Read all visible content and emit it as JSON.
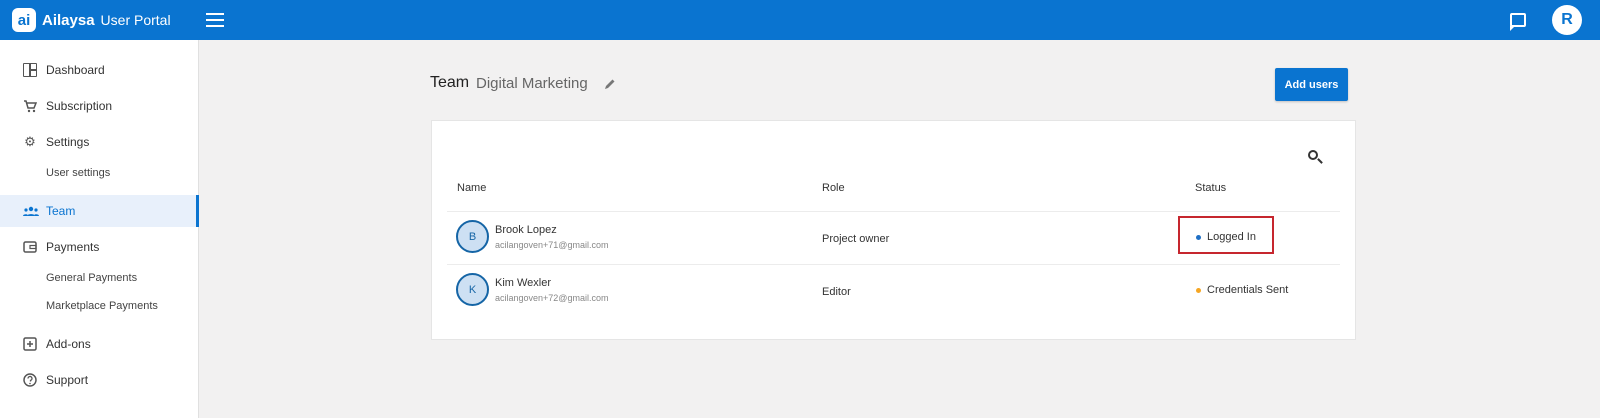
{
  "header": {
    "logo_mark": "ai",
    "brand": "Ailaysa",
    "portal": "User Portal",
    "user_initial": "R",
    "accent_color": "#0a74d0"
  },
  "sidebar": {
    "items": [
      {
        "label": "Dashboard",
        "icon": "dashboard-icon"
      },
      {
        "label": "Subscription",
        "icon": "cart-icon"
      },
      {
        "label": "Settings",
        "icon": "gear-icon"
      },
      {
        "label": "User settings"
      },
      {
        "label": "Team",
        "icon": "team-icon",
        "active": true
      },
      {
        "label": "Payments",
        "icon": "wallet-icon"
      },
      {
        "label": "General Payments"
      },
      {
        "label": "Marketplace Payments"
      },
      {
        "label": "Add-ons",
        "icon": "plus-box-icon"
      },
      {
        "label": "Support",
        "icon": "help-icon"
      }
    ]
  },
  "page": {
    "title": "Team",
    "team_name": "Digital Marketing",
    "add_users_label": "Add users"
  },
  "table": {
    "columns": [
      "Name",
      "Role",
      "Status"
    ],
    "rows": [
      {
        "initial": "B",
        "name": "Brook Lopez",
        "email": "acilangoven+71@gmail.com",
        "role": "Project owner",
        "status": "Logged In",
        "status_color": "#1f6fc5"
      },
      {
        "initial": "K",
        "name": "Kim Wexler",
        "email": "acilangoven+72@gmail.com",
        "role": "Editor",
        "status": "Credentials Sent",
        "status_color": "#f5a623"
      }
    ]
  }
}
